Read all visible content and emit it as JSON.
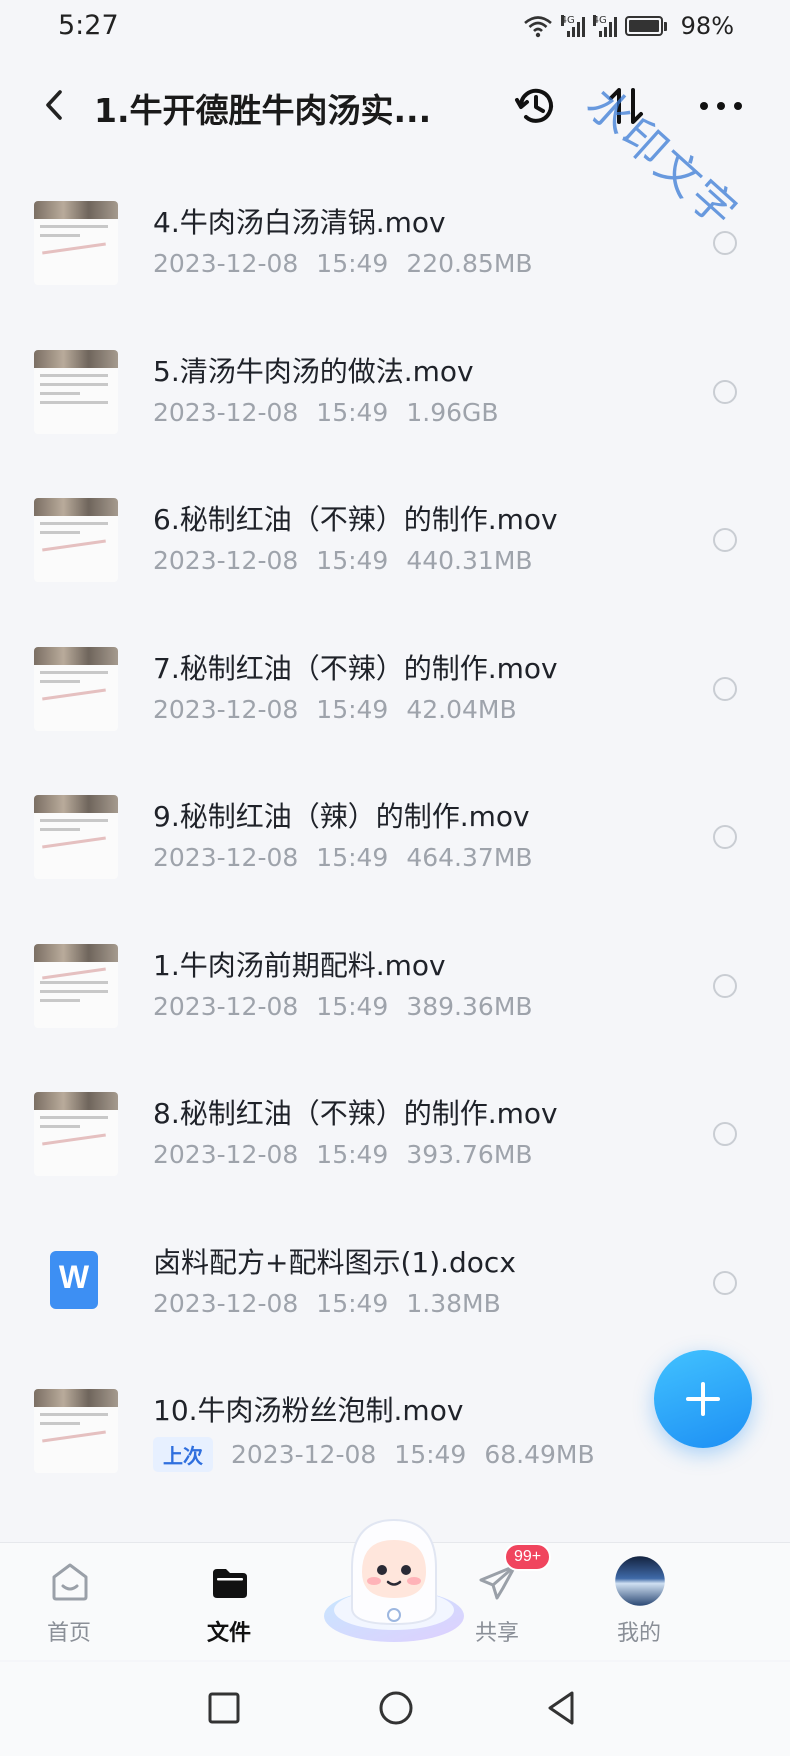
{
  "status_bar": {
    "time": "5:27",
    "network_1": "4G",
    "network_2": "4G",
    "battery": "98%"
  },
  "header": {
    "title": "1.牛开德胜牛肉汤实...",
    "watermark": "水印文字",
    "back_icon": "chevron-left-icon",
    "history_icon": "clock-history-icon",
    "sort_icon": "sort-arrows-icon",
    "more_icon": "more-dots-icon"
  },
  "files": [
    {
      "name": "4.牛肉汤白汤清锅.mov",
      "date": "2023-12-08",
      "time": "15:49",
      "size": "220.85MB",
      "type": "video",
      "badge": ""
    },
    {
      "name": "5.清汤牛肉汤的做法.mov",
      "date": "2023-12-08",
      "time": "15:49",
      "size": "1.96GB",
      "type": "video",
      "badge": ""
    },
    {
      "name": "6.秘制红油（不辣）的制作.mov",
      "date": "2023-12-08",
      "time": "15:49",
      "size": "440.31MB",
      "type": "video",
      "badge": ""
    },
    {
      "name": "7.秘制红油（不辣）的制作.mov",
      "date": "2023-12-08",
      "time": "15:49",
      "size": "42.04MB",
      "type": "video",
      "badge": ""
    },
    {
      "name": "9.秘制红油（辣）的制作.mov",
      "date": "2023-12-08",
      "time": "15:49",
      "size": "464.37MB",
      "type": "video",
      "badge": ""
    },
    {
      "name": "1.牛肉汤前期配料.mov",
      "date": "2023-12-08",
      "time": "15:49",
      "size": "389.36MB",
      "type": "video",
      "badge": ""
    },
    {
      "name": "8.秘制红油（不辣）的制作.mov",
      "date": "2023-12-08",
      "time": "15:49",
      "size": "393.76MB",
      "type": "video",
      "badge": ""
    },
    {
      "name": "卤料配方+配料图示(1).docx",
      "date": "2023-12-08",
      "time": "15:49",
      "size": "1.38MB",
      "type": "doc",
      "badge": ""
    },
    {
      "name": "10.牛肉汤粉丝泡制.mov",
      "date": "2023-12-08",
      "time": "15:49",
      "size": "68.49MB",
      "type": "video",
      "badge": "上次"
    }
  ],
  "doc_icon_letter": "W",
  "fab_icon": "plus-icon",
  "bottom_nav": {
    "home": "首页",
    "files": "文件",
    "share": "共享",
    "share_badge": "99+",
    "mine": "我的"
  },
  "colors": {
    "accent": "#1d8ff4",
    "badge": "#f0455e",
    "watermark": "#3a7bd5"
  }
}
